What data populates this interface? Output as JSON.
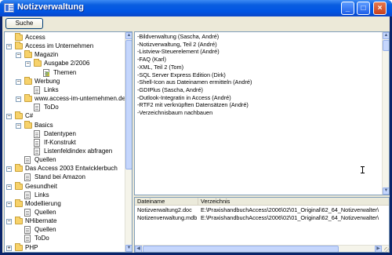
{
  "window": {
    "title": "Notizverwaltung",
    "buttons": {
      "minimize": "_",
      "maximize": "□",
      "close": "×"
    }
  },
  "toolbar": {
    "search_label": "Suche"
  },
  "tree": {
    "nodes": [
      {
        "label": "Access",
        "depth": 0,
        "type": "folder",
        "expander": ""
      },
      {
        "label": "Access im Unternehmen",
        "depth": 0,
        "type": "folder",
        "expander": "−"
      },
      {
        "label": "Magazin",
        "depth": 1,
        "type": "folder",
        "expander": "−"
      },
      {
        "label": "Ausgabe 2/2006",
        "depth": 2,
        "type": "folder",
        "expander": "−"
      },
      {
        "label": "Themen",
        "depth": 3,
        "type": "doc-color",
        "expander": ""
      },
      {
        "label": "Werbung",
        "depth": 1,
        "type": "folder",
        "expander": "−"
      },
      {
        "label": "Links",
        "depth": 2,
        "type": "doc",
        "expander": ""
      },
      {
        "label": "www.access-im-unternehmen.de",
        "depth": 1,
        "type": "folder",
        "expander": "−"
      },
      {
        "label": "ToDo",
        "depth": 2,
        "type": "doc",
        "expander": ""
      },
      {
        "label": "C#",
        "depth": 0,
        "type": "folder",
        "expander": "−"
      },
      {
        "label": "Basics",
        "depth": 1,
        "type": "folder",
        "expander": "−"
      },
      {
        "label": "Datentypen",
        "depth": 2,
        "type": "doc",
        "expander": ""
      },
      {
        "label": "If-Konstrukt",
        "depth": 2,
        "type": "doc",
        "expander": ""
      },
      {
        "label": "Listenfeldindex abfragen",
        "depth": 2,
        "type": "doc",
        "expander": ""
      },
      {
        "label": "Quellen",
        "depth": 1,
        "type": "doc",
        "expander": ""
      },
      {
        "label": "Das Access 2003 Entwicklerbuch",
        "depth": 0,
        "type": "folder",
        "expander": "−"
      },
      {
        "label": "Stand bei Amazon",
        "depth": 1,
        "type": "doc",
        "expander": ""
      },
      {
        "label": "Gesundheit",
        "depth": 0,
        "type": "folder",
        "expander": "−"
      },
      {
        "label": "Links",
        "depth": 1,
        "type": "doc",
        "expander": ""
      },
      {
        "label": "Modellierung",
        "depth": 0,
        "type": "folder",
        "expander": "−"
      },
      {
        "label": "Quellen",
        "depth": 1,
        "type": "doc",
        "expander": ""
      },
      {
        "label": "NHibernate",
        "depth": 0,
        "type": "folder",
        "expander": "−"
      },
      {
        "label": "Quellen",
        "depth": 1,
        "type": "doc",
        "expander": ""
      },
      {
        "label": "ToDo",
        "depth": 1,
        "type": "doc",
        "expander": ""
      },
      {
        "label": "PHP",
        "depth": 0,
        "type": "folder",
        "expander": "+"
      }
    ]
  },
  "notes": {
    "lines": [
      "-Bildverwaltung (Sascha, André)",
      "-Notizverwaltung, Teil 2 (André)",
      "-Listview-Steuerelement (André)",
      "-FAQ (Karl)",
      "-XML, Teil 2 (Tom)",
      "-SQL Server Express Edition (Dirk)",
      "-Shell-Icon aus Dateinamen ermitteln (André)",
      "-GDIPlus (Sascha, André)",
      "-Outlook-Integratin in Access (André)",
      "-RTF2 mit verknüpften Datensätzen (André)",
      "-Verzeichnisbaum nachbauen"
    ]
  },
  "files": {
    "columns": [
      "Dateiname",
      "Verzeichnis"
    ],
    "rows": [
      [
        "Notizverwaltung2.doc",
        "E:\\PraxishandbuchAccess\\2006\\02\\01_Original\\62_64_Notizverwalter\\"
      ],
      [
        "Notizenverwaltung.mdb",
        "E:\\PraxishandbuchAccess\\2006\\02\\01_Original\\62_64_Notizverwalter\\"
      ]
    ]
  },
  "scroll": {
    "up": "▲",
    "down": "▼",
    "left": "◀",
    "right": "▶"
  }
}
